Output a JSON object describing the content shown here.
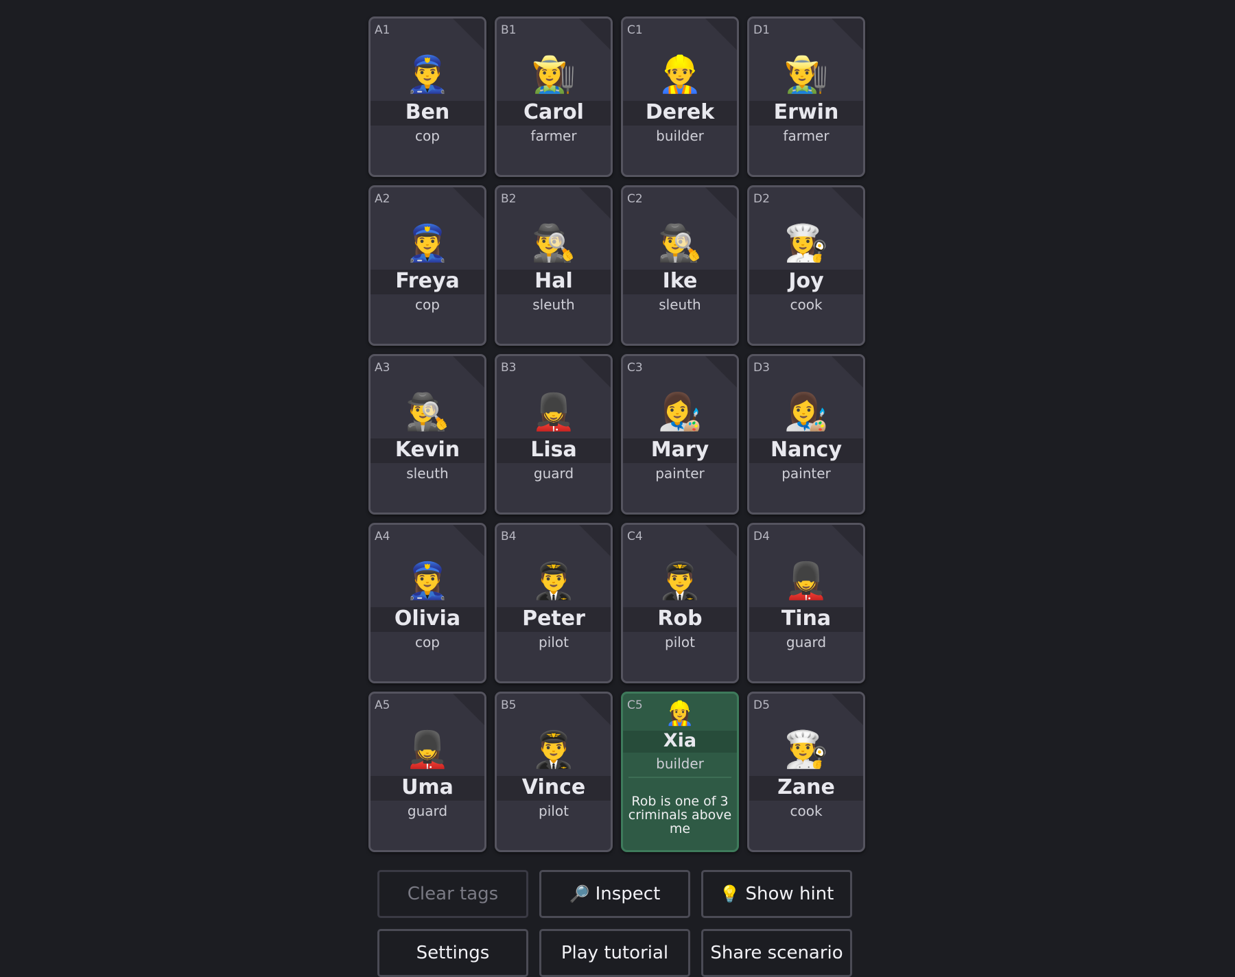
{
  "board": {
    "cards": [
      {
        "coord": "A1",
        "emoji": "👮‍♂️",
        "name": "Ben",
        "role": "cop"
      },
      {
        "coord": "B1",
        "emoji": "👩‍🌾",
        "name": "Carol",
        "role": "farmer"
      },
      {
        "coord": "C1",
        "emoji": "👷‍♂️",
        "name": "Derek",
        "role": "builder"
      },
      {
        "coord": "D1",
        "emoji": "👨‍🌾",
        "name": "Erwin",
        "role": "farmer"
      },
      {
        "coord": "A2",
        "emoji": "👮‍♀️",
        "name": "Freya",
        "role": "cop"
      },
      {
        "coord": "B2",
        "emoji": "🕵️‍♂️",
        "name": "Hal",
        "role": "sleuth"
      },
      {
        "coord": "C2",
        "emoji": "🕵️‍♂️",
        "name": "Ike",
        "role": "sleuth"
      },
      {
        "coord": "D2",
        "emoji": "👩‍🍳",
        "name": "Joy",
        "role": "cook"
      },
      {
        "coord": "A3",
        "emoji": "🕵️‍♂️",
        "name": "Kevin",
        "role": "sleuth"
      },
      {
        "coord": "B3",
        "emoji": "💂‍♀️",
        "name": "Lisa",
        "role": "guard"
      },
      {
        "coord": "C3",
        "emoji": "👩‍🎨",
        "name": "Mary",
        "role": "painter"
      },
      {
        "coord": "D3",
        "emoji": "👩‍🎨",
        "name": "Nancy",
        "role": "painter"
      },
      {
        "coord": "A4",
        "emoji": "👮‍♀️",
        "name": "Olivia",
        "role": "cop"
      },
      {
        "coord": "B4",
        "emoji": "👨‍✈️",
        "name": "Peter",
        "role": "pilot"
      },
      {
        "coord": "C4",
        "emoji": "👨‍✈️",
        "name": "Rob",
        "role": "pilot"
      },
      {
        "coord": "D4",
        "emoji": "💂‍♀️",
        "name": "Tina",
        "role": "guard"
      },
      {
        "coord": "A5",
        "emoji": "💂‍♀️",
        "name": "Uma",
        "role": "guard"
      },
      {
        "coord": "B5",
        "emoji": "👨‍✈️",
        "name": "Vince",
        "role": "pilot"
      },
      {
        "coord": "C5",
        "emoji": "👷‍♀️",
        "name": "Xia",
        "role": "builder",
        "revealed": true,
        "clue": "Rob is one of 3 criminals above me"
      },
      {
        "coord": "D5",
        "emoji": "👨‍🍳",
        "name": "Zane",
        "role": "cook"
      }
    ]
  },
  "controls": {
    "clear_tags": "Clear tags",
    "inspect_icon": "🔎",
    "inspect": "Inspect",
    "hint_icon": "💡",
    "show_hint": "Show hint",
    "settings": "Settings",
    "play_tutorial": "Play tutorial",
    "share_scenario": "Share scenario"
  },
  "colors": {
    "background": "#1c1d22",
    "card": "#35343f",
    "revealed_innocent": "#2f5a45"
  }
}
